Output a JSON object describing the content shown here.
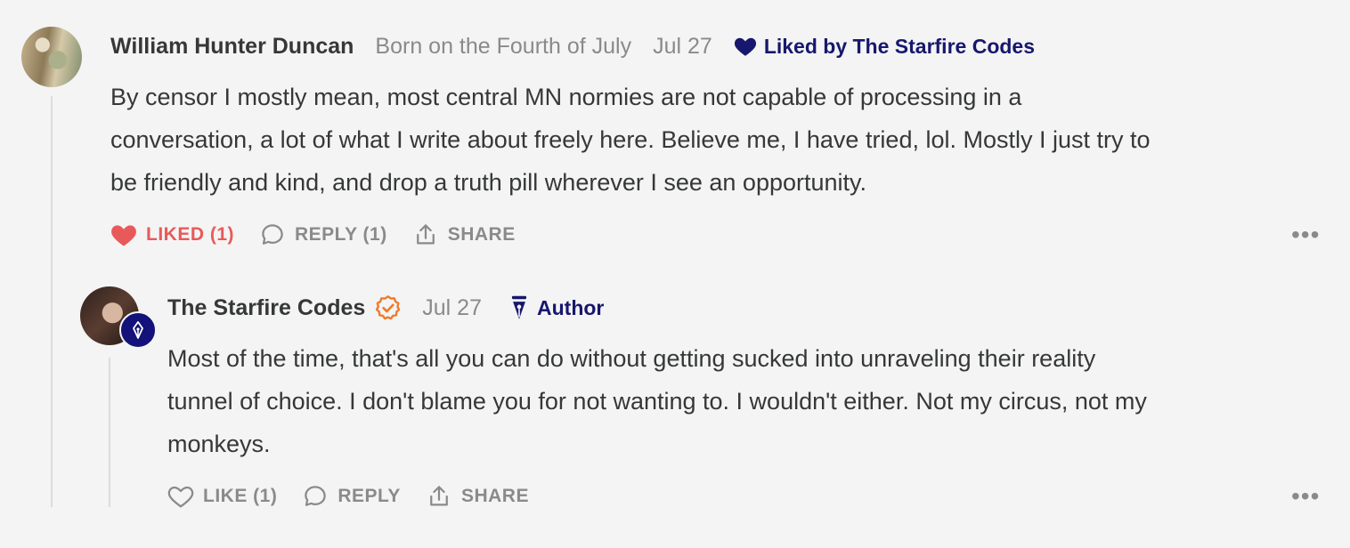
{
  "comment1": {
    "author": "William Hunter Duncan",
    "publication": "Born on the Fourth of July",
    "date": "Jul 27",
    "liked_by": "Liked by The Starfire Codes",
    "body_lines": [
      "By censor I mostly mean, most central MN normies are not capable of processing in a",
      "conversation, a lot of what I write about freely here. Believe me, I have tried, lol. Mostly I just try to",
      "be friendly and kind, and drop a truth pill wherever I see an opportunity."
    ],
    "actions": {
      "like": "LIKED (1)",
      "reply": "REPLY (1)",
      "share": "SHARE",
      "more": "•••"
    }
  },
  "comment2": {
    "author": "The Starfire Codes",
    "date": "Jul 27",
    "author_badge": "Author",
    "body_lines": [
      "Most of the time, that's all you can do without getting sucked into unraveling their reality",
      "tunnel of choice. I don't blame you for not wanting to. I wouldn't either. Not my circus, not my",
      "monkeys."
    ],
    "actions": {
      "like": "LIKE (1)",
      "reply": "REPLY",
      "share": "SHARE",
      "more": "•••"
    }
  },
  "colors": {
    "liked": "#e85a5a",
    "navy": "#17176e",
    "verified": "#f07a2a",
    "muted": "#8a8a8a"
  }
}
